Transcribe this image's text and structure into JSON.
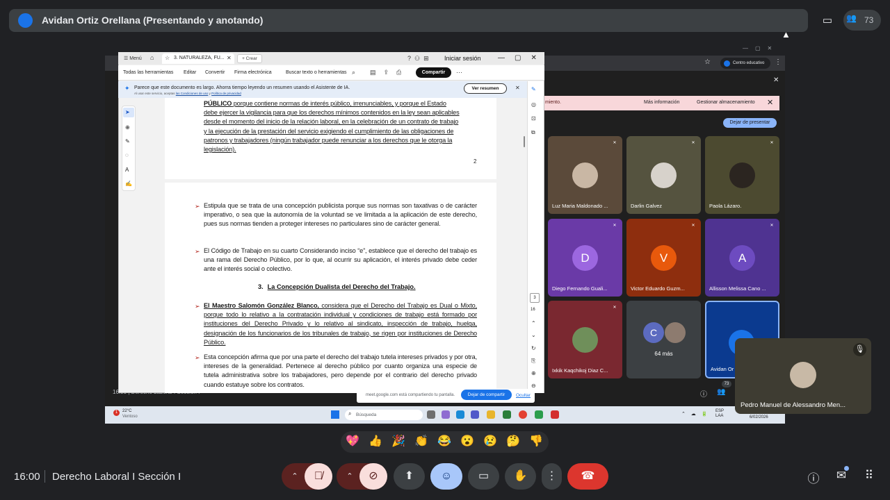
{
  "top_bar": {
    "presenter_title": "Avidan Ortiz Orellana (Presentando y anotando)",
    "participant_count": "73"
  },
  "shared_screen": {
    "browser": {
      "profile_label": "Centro educativo"
    },
    "storage_warning": {
      "text": "miento.",
      "more_info": "Más información",
      "manage": "Gestionar almacenamiento"
    },
    "stop_presenting": "Dejar de presentar",
    "tiles": [
      {
        "name": "Luz Maria Maldonado ...",
        "bg": "#5b4a3a",
        "kind": "photo",
        "photo_color": "#c9b7a4"
      },
      {
        "name": "Darlin Galvez",
        "bg": "#55533f",
        "kind": "photo",
        "photo_color": "#d7d2cb"
      },
      {
        "name": "Paola Lázaro.",
        "bg": "#4c4a30",
        "kind": "photo",
        "photo_color": "#2b2520"
      },
      {
        "name": "Diego Fernando Guali...",
        "bg": "#6a3aa7",
        "kind": "letter",
        "letter": "D",
        "letter_bg": "#9c67e0"
      },
      {
        "name": "Victor Eduardo Guzm...",
        "bg": "#8e2e0e",
        "kind": "letter",
        "letter": "V",
        "letter_bg": "#e8590c"
      },
      {
        "name": "Allisson Melissa Cano ...",
        "bg": "#4f3391",
        "kind": "letter",
        "letter": "A",
        "letter_bg": "#6d4bc0"
      },
      {
        "name": "Ixkik Kaqchikoj Diaz C...",
        "bg": "#7a2830",
        "kind": "photo",
        "photo_color": "#6f8f5a"
      },
      {
        "name": "",
        "bg": "#3c4043",
        "kind": "more",
        "more_text": "64 más",
        "letter": "C"
      },
      {
        "name": "Avidan Or",
        "bg": "#0b3a8f",
        "kind": "self"
      }
    ],
    "inner_time": "16:00",
    "inner_meeting": "Derecho Laboral I Sección I",
    "inner_count": "73",
    "taskbar": {
      "badge": "1",
      "temp": "22°C",
      "weather": "Ventoso",
      "search": "Búsqueda",
      "lang_1": "ESP",
      "lang_2": "LAA",
      "time": "",
      "date": "6/02/2026"
    }
  },
  "acrobat": {
    "tab_title": "3. NATURALEZA, FU...",
    "menu_label": "Menú",
    "new_tab_label": "Crear",
    "sign_in": "Iniciar sesión",
    "toolbar": {
      "all_tools": "Todas las herramientas",
      "edit": "Editar",
      "convert": "Convertir",
      "sign": "Firma electrónica",
      "search": "Buscar texto o herramientas",
      "share": "Compartir"
    },
    "ai_bar": {
      "message": "Parece que este documento es largo. Ahorra tiempo leyendo un resumen usando el Asistente de IA.",
      "sub_prefix": "Al usar este servicio, aceptas",
      "sub_link1": "las Condiciones de uso",
      "sub_mid": "y",
      "sub_link2": "Política de privacidad",
      "summary_button": "Ver resumen"
    },
    "page_indicator": "3",
    "page_total": "16",
    "document": {
      "page_a_lines": [
        {
          "bold": "PÚBLICO",
          "text": " porque contiene normas de interés público, irrenunciables, y porque el Estado"
        },
        {
          "text": "debe ejercer la vigilancia para que los derechos mínimos contenidos en la ley sean aplicables"
        },
        {
          "text": "desde el momento del inicio de la relación laboral, en la celebración de un contrato de trabajo"
        },
        {
          "text": "y la ejecución de la prestación del servicio exigiendo el cumplimiento de las obligaciones de"
        },
        {
          "text": "patronos y trabajadores (ningún trabajador puede renunciar a los derechos que le otorga la"
        },
        {
          "text": "legislación)."
        }
      ],
      "page_number": "2",
      "para1": "Estipula que se trata de una concepción publicista porque sus normas son taxativas o de carácter imperativo, o sea que la autonomía de la voluntad se ve limitada a la aplicación de este derecho, pues sus normas tienden a proteger intereses no particulares sino de carácter general.",
      "para2": "El Código de Trabajo en su cuarto Considerando inciso “e”, establece que el derecho del trabajo es una rama del Derecho Público, por lo que, al ocurrir su aplicación, el interés privado debe ceder ante el interés social o colectivo.",
      "heading_num": "3.",
      "heading": "La Concepción Dualista del Derecho del Trabajo.",
      "para3_bold": "El Maestro Salomón González Blanco,",
      "para3": " considera que el Derecho del Trabajo es Dual o Mixto, porque todo lo relativo a la contratación individual y condiciones de trabajo está formado por instituciones del Derecho Privado y lo relativo al sindicato, inspección de trabajo, huelga, designación de los funcionarios de los tribunales de trabajo, se rigen por instituciones de Derecho Público.",
      "para4": "Esta concepción afirma que por una parte el derecho del trabajo tutela intereses privados y por otra, intereses de la generalidad. Pertenece al derecho público por cuanto organiza una especie de tutela administrativa sobre los trabajadores, pero depende por el contrario del derecho privado cuando estatuye sobre los contratos."
    },
    "share_notice": {
      "text": "meet.google.com está compartiendo tu pantalla.",
      "stop": "Dejar de compartir",
      "hide": "Ocultar"
    }
  },
  "self_tile": {
    "name": "Pedro Manuel de Alessandro Men..."
  },
  "reactions": [
    "💖",
    "👍",
    "🎉",
    "👏",
    "😂",
    "😮",
    "😢",
    "🤔",
    "👎"
  ],
  "bottom_bar": {
    "time": "16:00",
    "meeting_name": "Derecho Laboral I Sección I"
  },
  "colors": {
    "meet_bg": "#202124",
    "leave_red": "#dc362e",
    "accent_blue": "#8ab4f8"
  }
}
